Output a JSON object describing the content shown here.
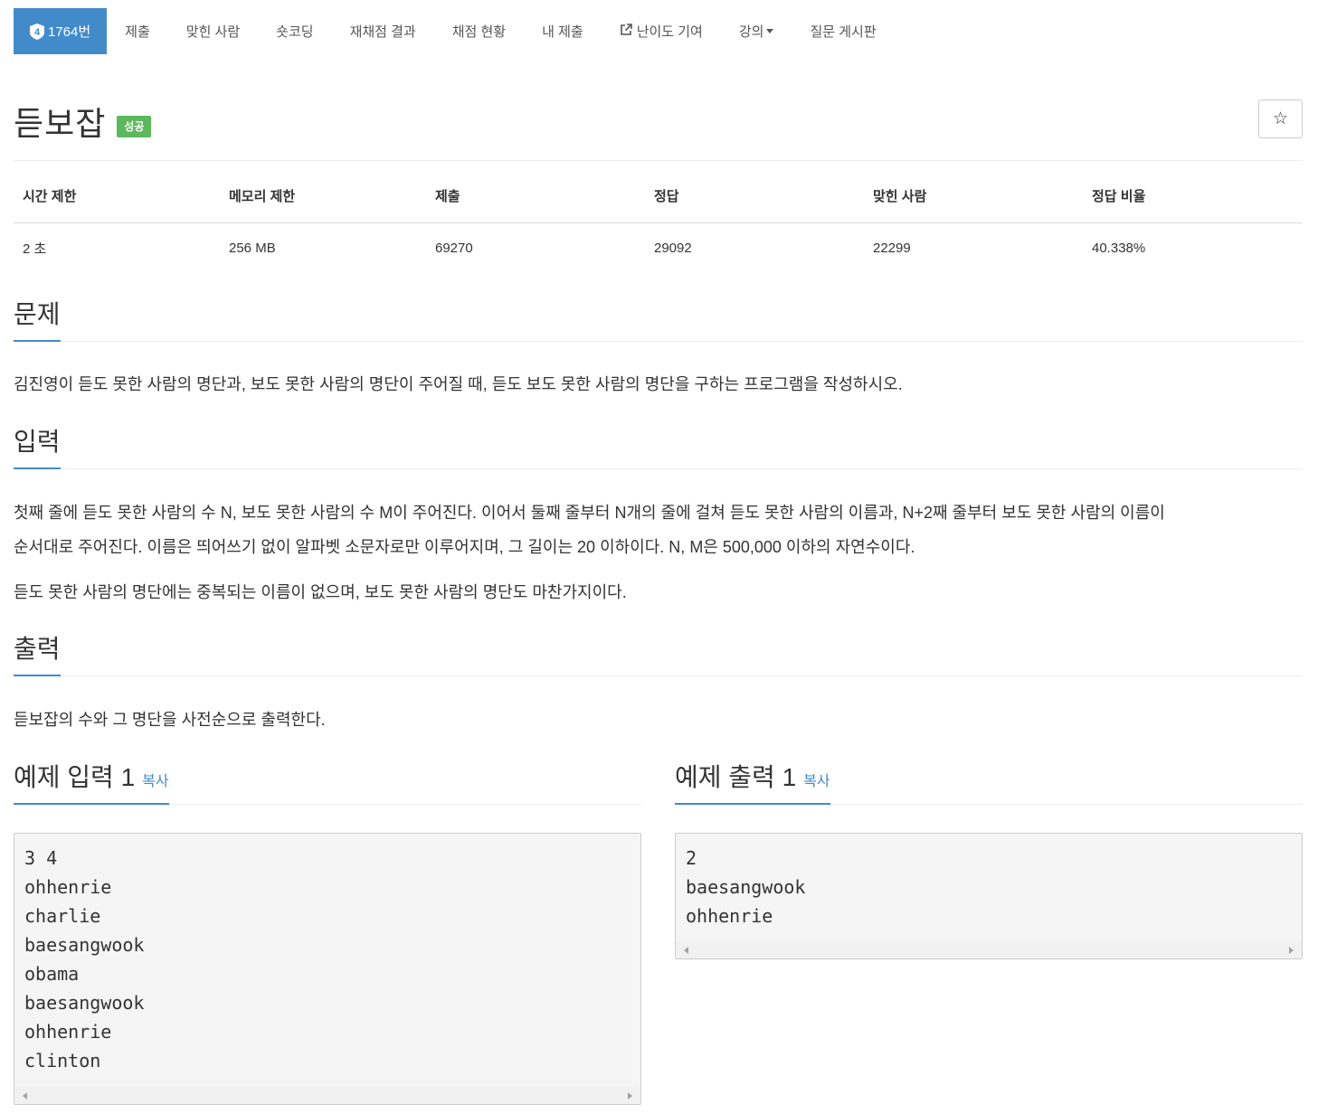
{
  "nav": {
    "problem_number": "1764번",
    "tier_badge_text": "4",
    "items": [
      "제출",
      "맞힌 사람",
      "숏코딩",
      "재채점 결과",
      "채점 현황",
      "내 제출",
      "난이도 기여",
      "강의",
      "질문 게시판"
    ]
  },
  "title": "듣보잡",
  "status_badge": "성공",
  "star_icon": "☆",
  "info": {
    "headers": [
      "시간 제한",
      "메모리 제한",
      "제출",
      "정답",
      "맞힌 사람",
      "정답 비율"
    ],
    "values": [
      "2 초",
      "256 MB",
      "69270",
      "29092",
      "22299",
      "40.338%"
    ]
  },
  "sections": {
    "problem": {
      "heading": "문제",
      "text": "김진영이 듣도 못한 사람의 명단과, 보도 못한 사람의 명단이 주어질 때, 듣도 보도 못한 사람의 명단을 구하는 프로그램을 작성하시오."
    },
    "input": {
      "heading": "입력",
      "text1_line1": "첫째 줄에 듣도 못한 사람의 수 N, 보도 못한 사람의 수 M이 주어진다. 이어서 둘째 줄부터 N개의 줄에 걸쳐 듣도 못한 사람의 이름과, N+2째 줄부터 보도 못한 사람의 이름이",
      "text1_line2": "순서대로 주어진다. 이름은 띄어쓰기 없이 알파벳 소문자로만 이루어지며, 그 길이는 20 이하이다. N, M은 500,000 이하의 자연수이다.",
      "text2": "듣도 못한 사람의 명단에는 중복되는 이름이 없으며, 보도 못한 사람의 명단도 마찬가지이다."
    },
    "output": {
      "heading": "출력",
      "text": "듣보잡의 수와 그 명단을 사전순으로 출력한다."
    }
  },
  "samples": {
    "input": {
      "heading": "예제 입력 1",
      "copy_label": "복사",
      "content": "3 4\nohhenrie\ncharlie\nbaesangwook\nobama\nbaesangwook\nohhenrie\nclinton"
    },
    "output": {
      "heading": "예제 출력 1",
      "copy_label": "복사",
      "content": "2\nbaesangwook\nohhenrie"
    }
  },
  "colors": {
    "accent": "#428bca",
    "success": "#5cb85c"
  }
}
